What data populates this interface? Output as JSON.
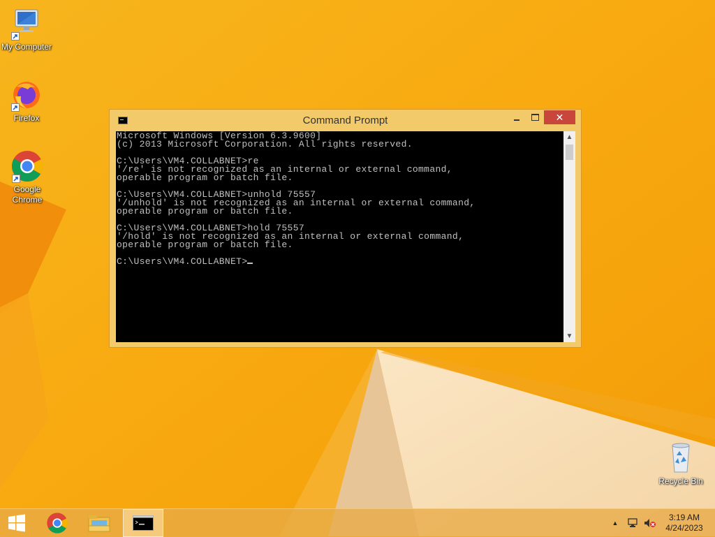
{
  "desktop": {
    "icons": [
      {
        "label": "My Computer"
      },
      {
        "label": "Firefox"
      },
      {
        "label": "Google Chrome"
      },
      {
        "label": "Recycle Bin"
      }
    ]
  },
  "window": {
    "title": "Command Prompt",
    "console_lines": [
      "Microsoft Windows [Version 6.3.9600]",
      "(c) 2013 Microsoft Corporation. All rights reserved.",
      "",
      "C:\\Users\\VM4.COLLABNET>re",
      "'/re' is not recognized as an internal or external command,",
      "operable program or batch file.",
      "",
      "C:\\Users\\VM4.COLLABNET>unhold 75557",
      "'/unhold' is not recognized as an internal or external command,",
      "operable program or batch file.",
      "",
      "C:\\Users\\VM4.COLLABNET>hold 75557",
      "'/hold' is not recognized as an internal or external command,",
      "operable program or batch file.",
      "",
      "C:\\Users\\VM4.COLLABNET>"
    ],
    "buttons": {
      "minimize": "minimize",
      "maximize": "maximize",
      "close": "close"
    }
  },
  "taskbar": {
    "items": [
      "start",
      "chrome",
      "file-explorer",
      "command-prompt"
    ],
    "clock": {
      "time": "3:19 AM",
      "date": "4/24/2023"
    }
  },
  "colors": {
    "wallpaper": "#f7a70f",
    "window_frame": "#f3ca6a",
    "close_button": "#c9463d",
    "console_bg": "#000000",
    "console_text": "#c0c0c0"
  }
}
